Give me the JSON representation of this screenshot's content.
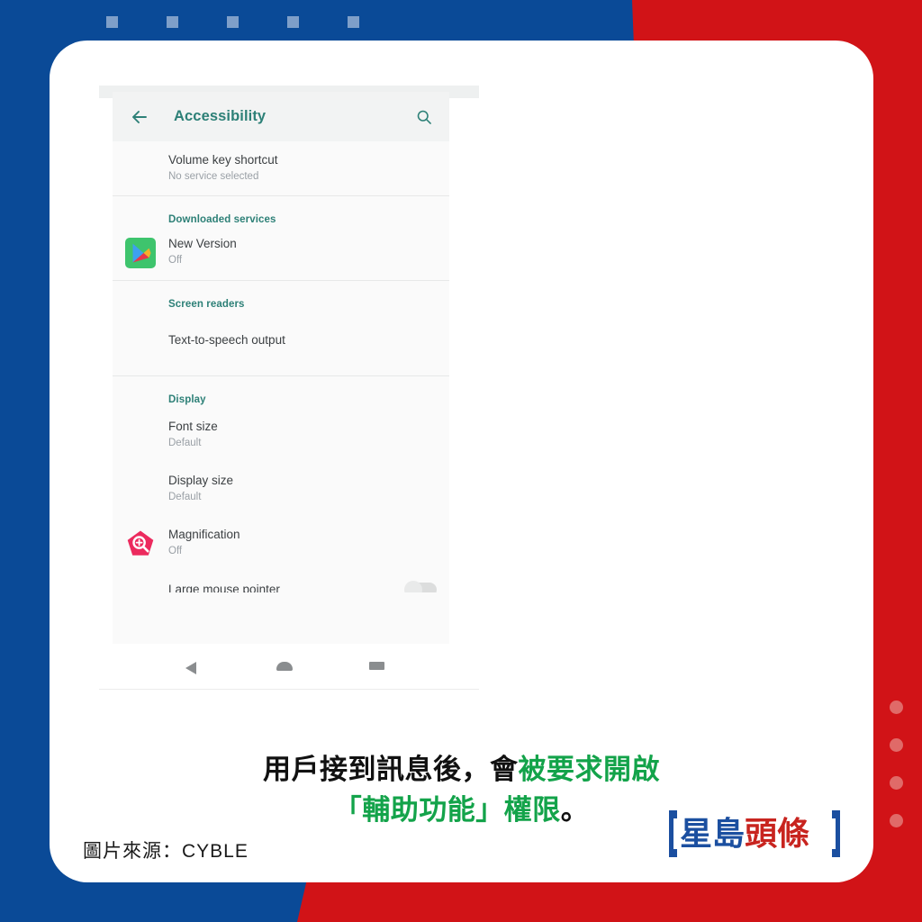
{
  "theme": {
    "blue": "#0a4a97",
    "red": "#d11317",
    "teal": "#2d8077",
    "caption_green": "#13a34a",
    "square_blue": "#7e9fc9",
    "dot_red": "#e06a68"
  },
  "decor": {
    "top_squares_count": 5,
    "right_dots_count": 4
  },
  "screenshot": {
    "appbar": {
      "back_icon": "arrow-left-icon",
      "title": "Accessibility",
      "search_icon": "search-icon"
    },
    "sections": [
      {
        "header": "",
        "rows": [
          {
            "icon": null,
            "title": "Volume key shortcut",
            "subtitle": "No service selected",
            "toggle": false
          }
        ]
      },
      {
        "header": "Downloaded services",
        "rows": [
          {
            "icon": "google-play-icon",
            "title": "New Version",
            "subtitle": "Off",
            "toggle": false
          }
        ]
      },
      {
        "header": "Screen readers",
        "rows": [
          {
            "icon": null,
            "title": "Text-to-speech output",
            "subtitle": "",
            "toggle": false
          }
        ]
      },
      {
        "header": "Display",
        "rows": [
          {
            "icon": null,
            "title": "Font size",
            "subtitle": "Default",
            "toggle": false
          },
          {
            "icon": null,
            "title": "Display size",
            "subtitle": "Default",
            "toggle": false
          },
          {
            "icon": "magnification-icon",
            "title": "Magnification",
            "subtitle": "Off",
            "toggle": false
          },
          {
            "icon": null,
            "title": "Large mouse pointer",
            "subtitle": "",
            "toggle": true
          }
        ]
      }
    ],
    "navbar": {
      "back": "nav-back-icon",
      "home": "nav-home-icon",
      "recents": "nav-recents-icon"
    }
  },
  "caption": {
    "line1_black": "用戶接到訊息後，會",
    "line1_green": "被要求開啟",
    "line2_green": "「輔助功能」權限",
    "line2_black": "。"
  },
  "source": {
    "text": "圖片來源：CYBLE"
  },
  "logo": {
    "char1": "星",
    "char2": "島",
    "char3": "頭",
    "char4": "條"
  }
}
